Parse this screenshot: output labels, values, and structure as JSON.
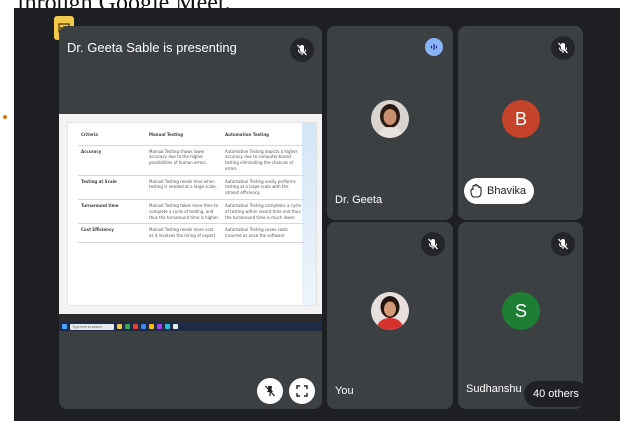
{
  "caption": "through Google Meet.",
  "presentation": {
    "title": "Dr. Geeta Sable is presenting",
    "slide": {
      "headers": [
        "Criteria",
        "Manual Testing",
        "Automation Testing"
      ],
      "rows": [
        [
          "Accuracy",
          "Manual Testing shows lower accuracy due to the higher possibilities of human errors.",
          "Automation Testing depicts a higher accuracy due to computer-based testing eliminating the chances of errors"
        ],
        [
          "Testing at Scale",
          "Manual Testing needs time when testing is needed at a large scale.",
          "Automation Testing easily performs testing at a large scale with the utmost efficiency."
        ],
        [
          "Turnaround time",
          "Manual Testing takes more time to complete a cycle of testing, and thus the turnaround time is higher.",
          "Automation Testing completes a cycle of testing within record time and thus the turnaround time is much lower."
        ],
        [
          "Cost Efficiency",
          "Manual Testing needs more cost as it involves the hiring of expert",
          "Automation Testing saves costs incurred as once the software"
        ]
      ]
    },
    "taskbar_search_placeholder": "Type here to search"
  },
  "participants": {
    "geeta": {
      "name": "Dr. Geeta"
    },
    "bhavika": {
      "initial": "B",
      "name": "Bhavika",
      "avatar_color": "#c5432a"
    },
    "you": {
      "name": "You"
    },
    "others": {
      "initial": "S",
      "name": "Sudhanshu",
      "others_label": "40 others",
      "avatar_color": "#1e7e34"
    }
  },
  "icons": {
    "mic_off": "mic-off-icon",
    "speaking": "audio-wave-icon",
    "hand": "raised-hand-icon",
    "pin": "unpin-icon",
    "fullscreen": "fullscreen-icon"
  }
}
